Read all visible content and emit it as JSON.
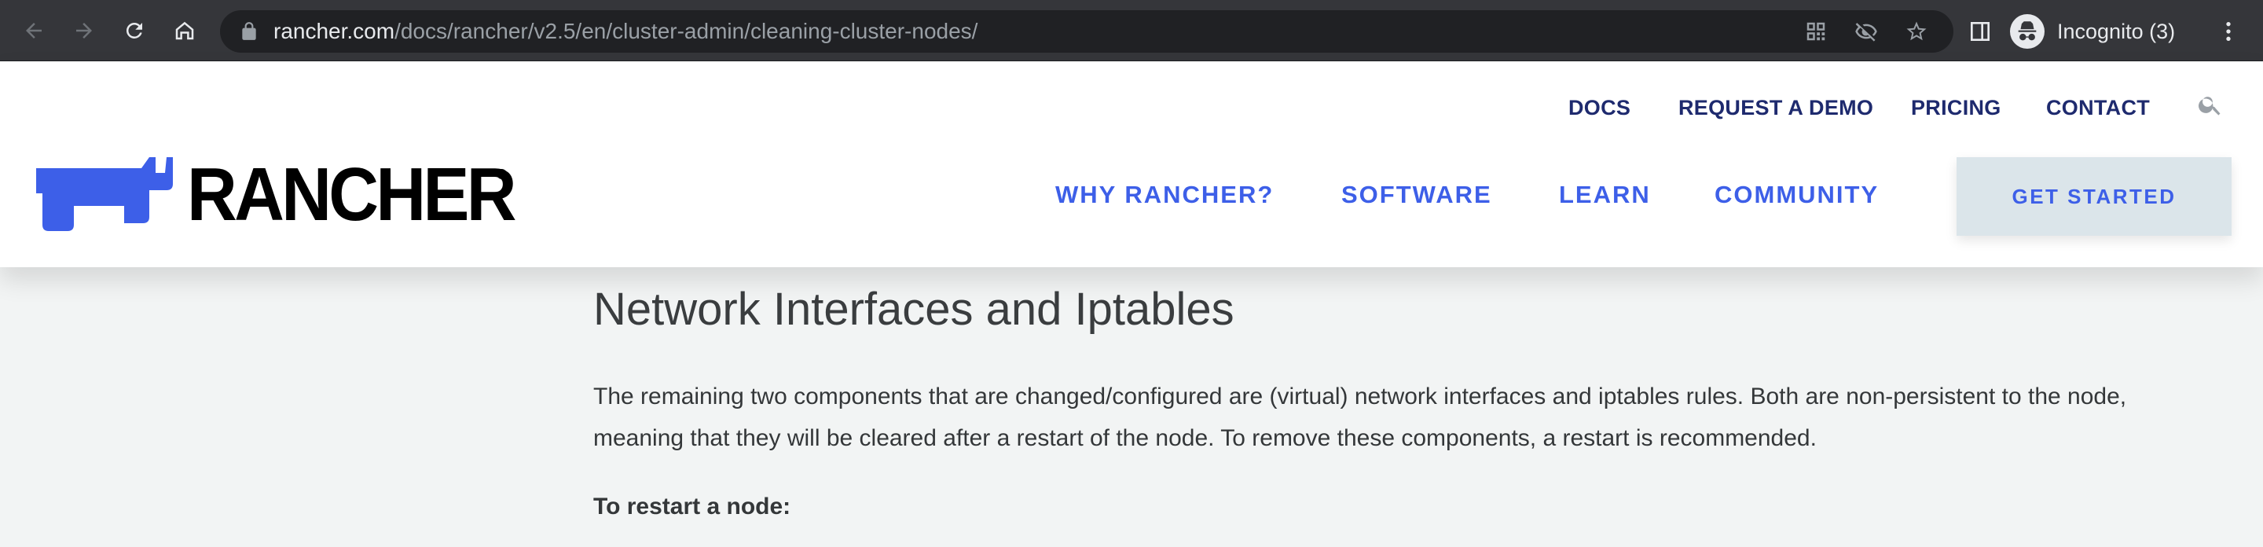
{
  "browser": {
    "url_host": "rancher.com",
    "url_path": "/docs/rancher/v2.5/en/cluster-admin/cleaning-cluster-nodes/",
    "profile_label": "Incognito (3)",
    "icons": [
      "back-icon",
      "forward-icon",
      "reload-icon",
      "home-icon",
      "lock-icon",
      "qr-code-icon",
      "eye-off-icon",
      "star-icon",
      "side-panel-icon",
      "incognito-icon",
      "more-icon"
    ]
  },
  "header": {
    "top_links": [
      "DOCS",
      "REQUEST A DEMO",
      "PRICING",
      "CONTACT"
    ],
    "brand": "RANCHER",
    "brand_reg": "®",
    "main_links": [
      "WHY RANCHER?",
      "SOFTWARE",
      "LEARN",
      "COMMUNITY"
    ],
    "cta": "GET STARTED",
    "colors": {
      "nav_dark": "#1e2a6e",
      "accent": "#3d5fe8",
      "cta_bg": "#dbe5ea"
    }
  },
  "content": {
    "heading": "Network Interfaces and Iptables",
    "paragraph": "The remaining two components that are changed/configured are (virtual) network interfaces and iptables rules. Both are non-persistent to the node, meaning that they will be cleared after a restart of the node. To remove these components, a restart is recommended.",
    "subheading": "To restart a node:"
  }
}
